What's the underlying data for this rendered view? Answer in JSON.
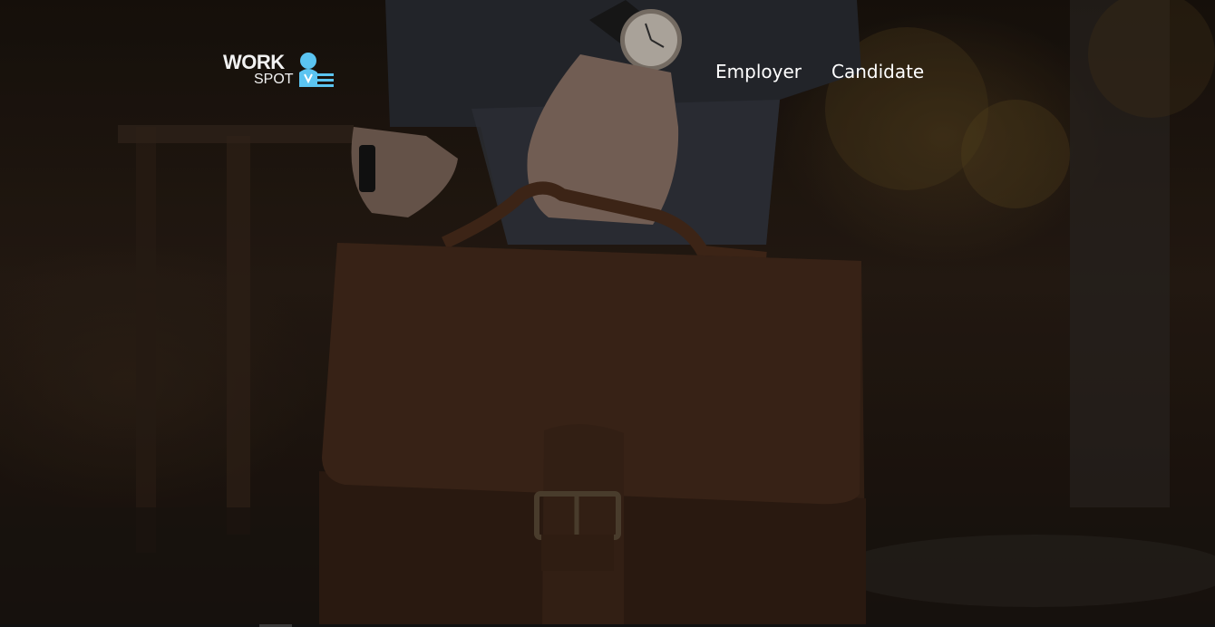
{
  "logo": {
    "word": "WORK",
    "sub": "SPOT",
    "accent_color": "#5bc4f1"
  },
  "nav": {
    "items": [
      {
        "label": "Employer"
      },
      {
        "label": "Candidate"
      }
    ]
  },
  "hero": {
    "image": "person-holding-leather-briefcase"
  }
}
